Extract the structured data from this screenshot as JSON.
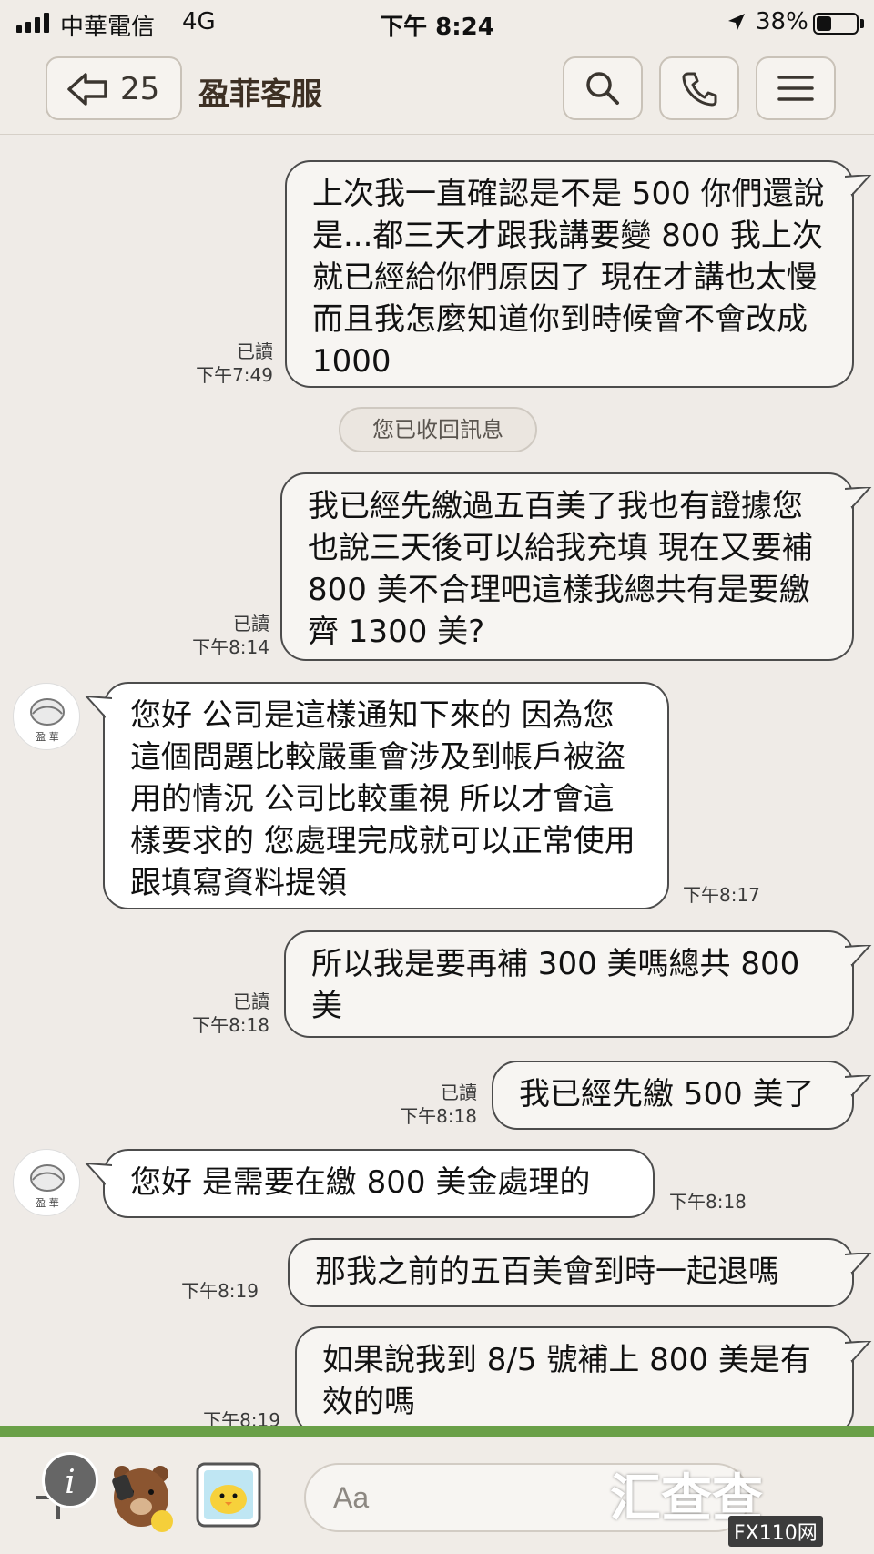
{
  "status_bar": {
    "carrier": "中華電信",
    "network": "4G",
    "time": "下午 8:24",
    "battery": "38%",
    "battery_level": 0.38
  },
  "header": {
    "back_count": "25",
    "title": "盈菲客服"
  },
  "system_notice": "您已收回訊息",
  "messages": [
    {
      "direction": "out",
      "read": "已讀",
      "time": "下午7:49",
      "text": "上次我一直確認是不是 500 你們還說是...都三天才跟我講要變 800 我上次就已經給你們原因了 現在才講也太慢 而且我怎麼知道你到時候會不會改成 1000"
    },
    {
      "direction": "out",
      "read": "已讀",
      "time": "下午8:14",
      "text": "我已經先繳過五百美了我也有證據您也說三天後可以給我充填 現在又要補 800 美不合理吧這樣我總共有是要繳齊 1300 美?"
    },
    {
      "direction": "in",
      "time": "下午8:17",
      "text": "您好 公司是這樣通知下來的  因為您這個問題比較嚴重會涉及到帳戶被盜用的情況 公司比較重視 所以才會這樣要求的 您處理完成就可以正常使用跟填寫資料提領"
    },
    {
      "direction": "out",
      "read": "已讀",
      "time": "下午8:18",
      "text": "所以我是要再補 300 美嗎總共 800 美"
    },
    {
      "direction": "out",
      "read": "已讀",
      "time": "下午8:18",
      "text": "我已經先繳 500 美了"
    },
    {
      "direction": "in",
      "time": "下午8:18",
      "text": "您好 是需要在繳 800 美金處理的"
    },
    {
      "direction": "out",
      "time": "下午8:19",
      "text": "那我之前的五百美會到時一起退嗎"
    },
    {
      "direction": "out",
      "time": "下午8:19",
      "text": "如果說我到 8/5 號補上 800 美是有效的嗎"
    }
  ],
  "avatar_label": "盈 華",
  "input": {
    "placeholder": "Aa"
  },
  "watermark": {
    "text": "汇查查",
    "badge": "FX110网"
  },
  "icons": [
    "back-arrow-icon",
    "search-icon",
    "phone-icon",
    "menu-icon",
    "plus-icon",
    "info-icon",
    "bear-sticker-icon",
    "chick-sticker-icon",
    "location-arrow-icon"
  ]
}
